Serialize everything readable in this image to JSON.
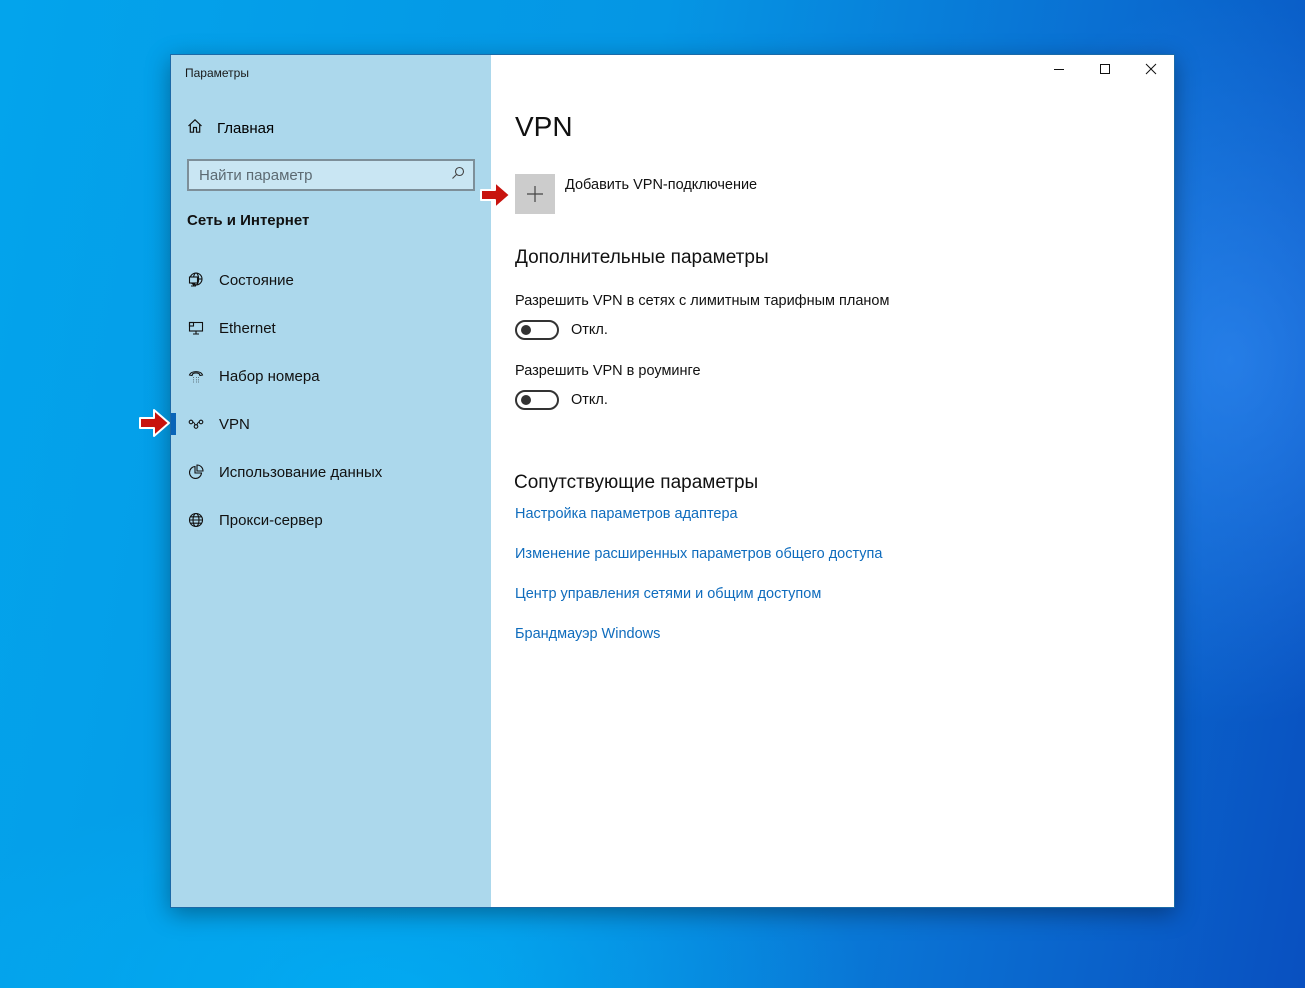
{
  "window": {
    "app_title": "Параметры",
    "controls": {
      "minimize": "minimize-icon",
      "maximize": "maximize-icon",
      "close": "close-icon"
    }
  },
  "sidebar": {
    "home_label": "Главная",
    "home_icon": "home-icon",
    "search": {
      "placeholder": "Найти параметр",
      "value": "",
      "icon": "search-icon"
    },
    "section_label": "Сеть и Интернет",
    "items": [
      {
        "label": "Состояние",
        "icon": "network-status-icon",
        "active": false
      },
      {
        "label": "Ethernet",
        "icon": "ethernet-icon",
        "active": false
      },
      {
        "label": "Набор номера",
        "icon": "dialup-icon",
        "active": false
      },
      {
        "label": "VPN",
        "icon": "vpn-icon",
        "active": true
      },
      {
        "label": "Использование данных",
        "icon": "data-usage-icon",
        "active": false
      },
      {
        "label": "Прокси-сервер",
        "icon": "globe-icon",
        "active": false
      }
    ]
  },
  "main": {
    "title": "VPN",
    "add_vpn_label": "Добавить VPN-подключение",
    "advanced_heading": "Дополнительные параметры",
    "settings": [
      {
        "label": "Разрешить VPN в сетях с лимитным тарифным планом",
        "state": "Откл.",
        "on": false
      },
      {
        "label": "Разрешить VPN в роуминге",
        "state": "Откл.",
        "on": false
      }
    ],
    "related_heading": "Сопутствующие параметры",
    "related_links": [
      "Настройка параметров адаптера",
      "Изменение расширенных параметров общего доступа",
      "Центр управления сетями и общим доступом",
      "Брандмауэр Windows"
    ]
  },
  "annotations": {
    "arrow_color": "#c8130e",
    "targets": [
      "sidebar-item-vpn",
      "add-vpn-button"
    ]
  },
  "colors": {
    "sidebar_bg": "#acd8ec",
    "link": "#0f6cbd",
    "active_indicator": "#0a64b8",
    "add_button_bg": "#cccccc"
  }
}
